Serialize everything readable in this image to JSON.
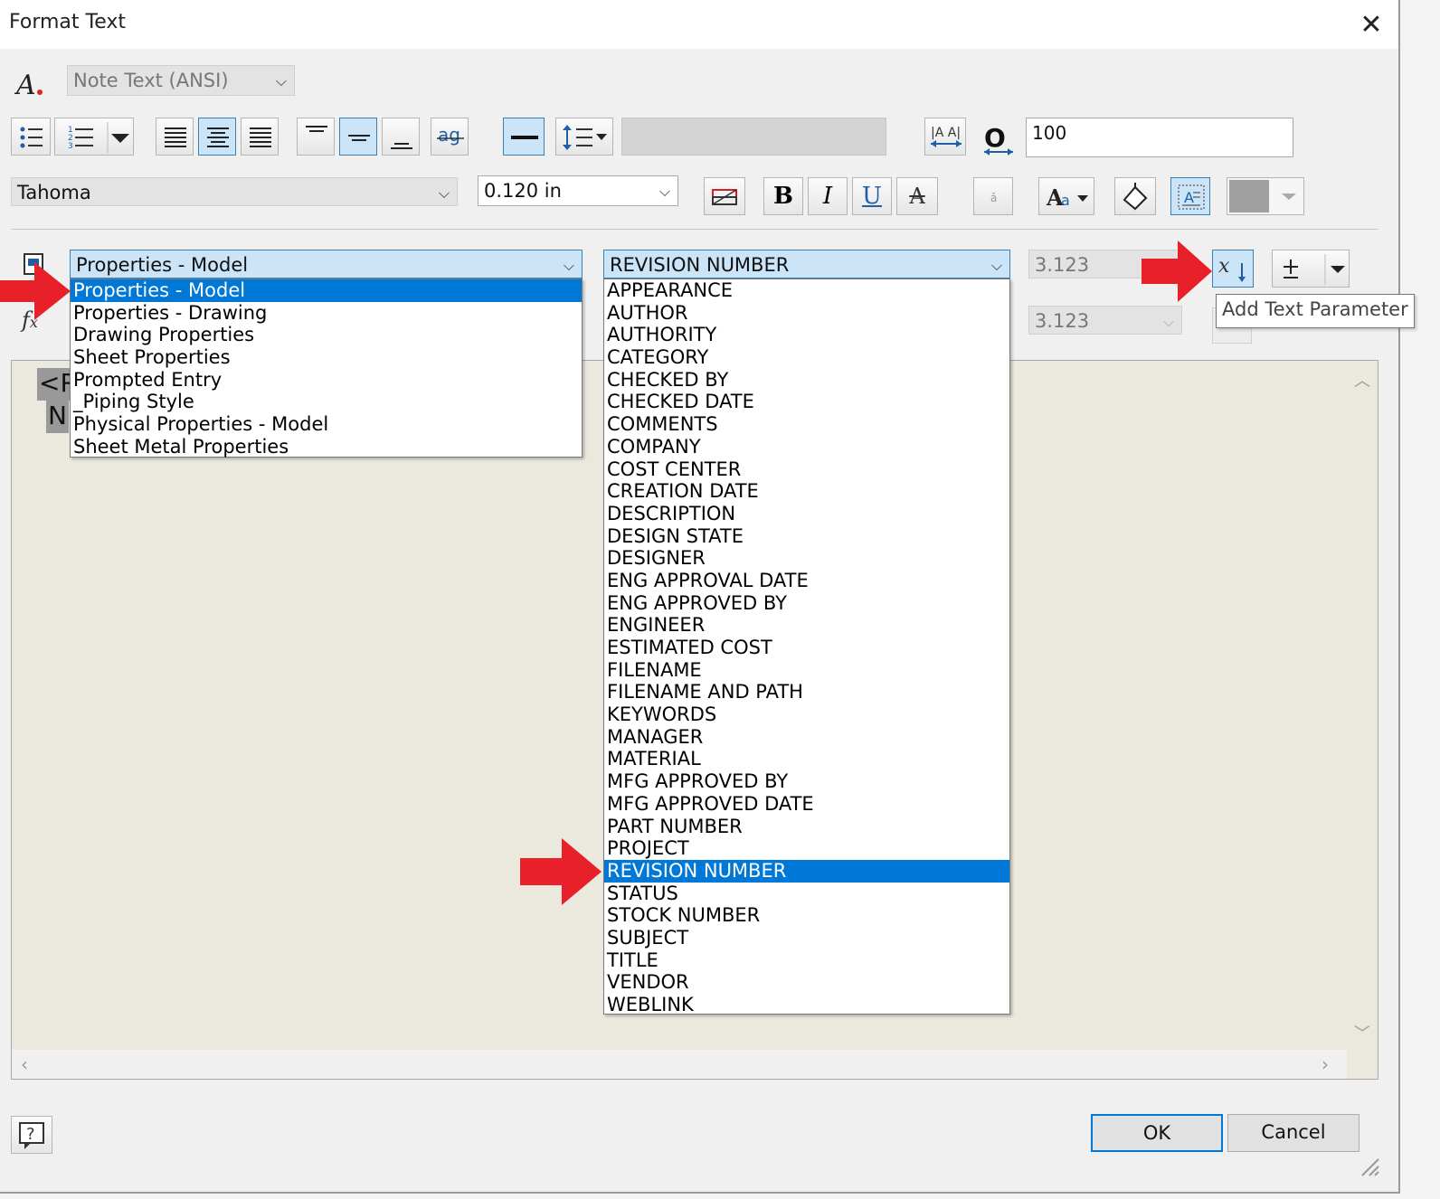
{
  "window": {
    "title": "Format Text",
    "close_label": "✕"
  },
  "style": {
    "value": "Note Text (ANSI)"
  },
  "font": {
    "value": "Tahoma"
  },
  "size": {
    "value": "0.120 in"
  },
  "stretch": {
    "value": "100"
  },
  "toolbar": {
    "bold": "B",
    "italic": "I",
    "underline": "U",
    "strike": "A"
  },
  "type_combo": {
    "selected": "Properties - Model",
    "options": [
      "Properties - Model",
      "Properties - Drawing",
      "Drawing Properties",
      "Sheet Properties",
      "Prompted Entry",
      "_Piping Style",
      "Physical Properties - Model",
      "Sheet Metal Properties"
    ],
    "highlighted_index": 0
  },
  "property_combo": {
    "selected": "REVISION NUMBER",
    "options": [
      "APPEARANCE",
      "AUTHOR",
      "AUTHORITY",
      "CATEGORY",
      "CHECKED BY",
      "CHECKED DATE",
      "COMMENTS",
      "COMPANY",
      "COST CENTER",
      "CREATION DATE",
      "DESCRIPTION",
      "DESIGN STATE",
      "DESIGNER",
      "ENG APPROVAL DATE",
      "ENG APPROVED BY",
      "ENGINEER",
      "ESTIMATED COST",
      "FILENAME",
      "FILENAME AND PATH",
      "KEYWORDS",
      "MANAGER",
      "MATERIAL",
      "MFG APPROVED BY",
      "MFG APPROVED DATE",
      "PART NUMBER",
      "PROJECT",
      "REVISION NUMBER",
      "STATUS",
      "STOCK NUMBER",
      "SUBJECT",
      "TITLE",
      "VENDOR",
      "WEBLINK"
    ],
    "highlighted_index": 26
  },
  "precision1": {
    "value": "3.123"
  },
  "precision2": {
    "value": "3.123"
  },
  "tooltip": {
    "text": "Add Text Parameter"
  },
  "editor": {
    "line1": "<R",
    "line2": "N"
  },
  "buttons": {
    "ok": "OK",
    "cancel": "Cancel"
  },
  "colors": {
    "highlight": "#0078d7",
    "arrow": "#e8202a",
    "editor_bg": "#ebe9dd"
  }
}
